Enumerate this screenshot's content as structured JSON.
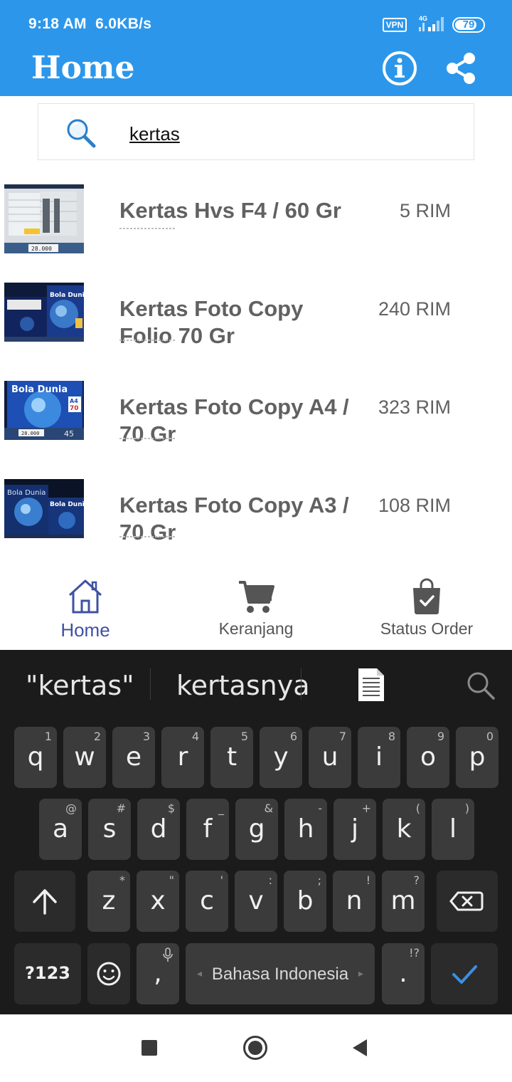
{
  "status_bar": {
    "time": "9:18 AM",
    "speed": "6.0KB/s",
    "vpn": "VPN",
    "network": "4G",
    "battery": "79",
    "battery_level": 0.79
  },
  "header": {
    "title": "Home",
    "info_icon": "info-circle-icon",
    "share_icon": "share-icon",
    "background": "#2c97ea"
  },
  "search": {
    "value": "kertas",
    "icon": "magnifier-icon"
  },
  "products": [
    {
      "name": "Kertas Hvs  F4 / 60 Gr",
      "qty": "5 RIM"
    },
    {
      "name": "Kertas Foto Copy Folio 70 Gr",
      "qty": "240 RIM"
    },
    {
      "name": "Kertas Foto Copy  A4 / 70 Gr",
      "qty": "323 RIM"
    },
    {
      "name": "Kertas Foto Copy  A3 / 70 Gr",
      "qty": "108 RIM"
    }
  ],
  "bottom_nav": {
    "items": [
      {
        "label": "Home",
        "icon": "home-icon",
        "active": true
      },
      {
        "label": "Keranjang",
        "icon": "cart-icon",
        "active": false
      },
      {
        "label": "Status Order",
        "icon": "shopping-bag-check-icon",
        "active": false
      }
    ],
    "active_color": "#3f51a3"
  },
  "keyboard": {
    "suggestions": [
      "\"kertas\"",
      "kertasnya"
    ],
    "row1": [
      {
        "key": "q",
        "hint": "1"
      },
      {
        "key": "w",
        "hint": "2"
      },
      {
        "key": "e",
        "hint": "3"
      },
      {
        "key": "r",
        "hint": "4"
      },
      {
        "key": "t",
        "hint": "5"
      },
      {
        "key": "y",
        "hint": "6"
      },
      {
        "key": "u",
        "hint": "7"
      },
      {
        "key": "i",
        "hint": "8"
      },
      {
        "key": "o",
        "hint": "9"
      },
      {
        "key": "p",
        "hint": "0"
      }
    ],
    "row2": [
      {
        "key": "a",
        "hint": "@"
      },
      {
        "key": "s",
        "hint": "#"
      },
      {
        "key": "d",
        "hint": "$"
      },
      {
        "key": "f",
        "hint": "_"
      },
      {
        "key": "g",
        "hint": "&"
      },
      {
        "key": "h",
        "hint": "-"
      },
      {
        "key": "j",
        "hint": "+"
      },
      {
        "key": "k",
        "hint": "("
      },
      {
        "key": "l",
        "hint": ")"
      }
    ],
    "row3": [
      {
        "key": "z",
        "hint": "*"
      },
      {
        "key": "x",
        "hint": "\""
      },
      {
        "key": "c",
        "hint": "'"
      },
      {
        "key": "v",
        "hint": ":"
      },
      {
        "key": "b",
        "hint": ";"
      },
      {
        "key": "n",
        "hint": "!"
      },
      {
        "key": "m",
        "hint": "?"
      }
    ],
    "symbols_label": "?123",
    "comma": ",",
    "period": ".",
    "period_hint": "!?",
    "space_label": "Bahasa Indonesia",
    "enter_color": "#3d8fe0"
  }
}
